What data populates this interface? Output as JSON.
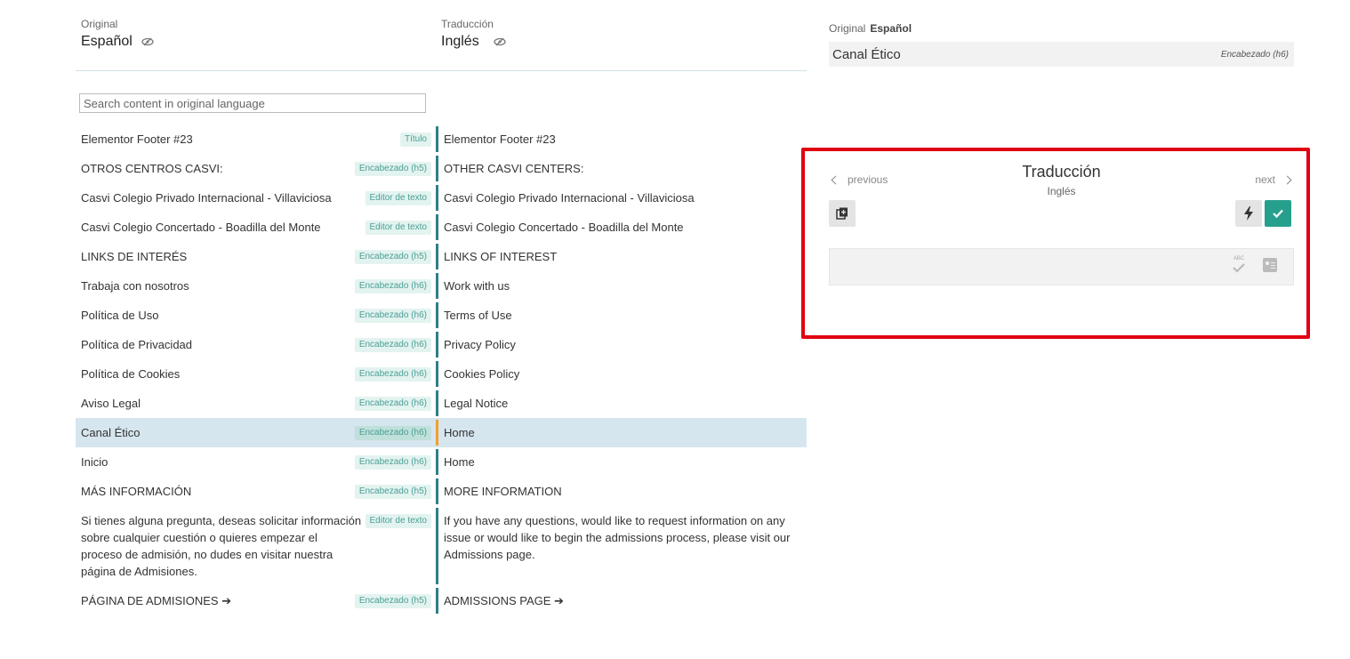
{
  "header": {
    "original_caption": "Original",
    "original_lang": "Español",
    "translation_caption": "Traducción",
    "translation_lang": "Inglés"
  },
  "search": {
    "placeholder": "Search content in original language"
  },
  "rows": [
    {
      "orig": "Elementor Footer #23",
      "tag": "Título",
      "trans": "Elementor Footer #23"
    },
    {
      "orig": "OTROS CENTROS CASVI:",
      "tag": "Encabezado (h5)",
      "trans": "OTHER CASVI CENTERS:"
    },
    {
      "orig": "Casvi Colegio Privado Internacional - Villaviciosa",
      "tag": "Editor de texto",
      "trans": "Casvi Colegio Privado Internacional - Villaviciosa"
    },
    {
      "orig": "Casvi Colegio Concertado - Boadilla del Monte",
      "tag": "Editor de texto",
      "trans": "Casvi Colegio Concertado - Boadilla del Monte"
    },
    {
      "orig": "LINKS DE INTERÉS",
      "tag": "Encabezado (h5)",
      "trans": "LINKS OF INTEREST"
    },
    {
      "orig": "Trabaja con nosotros",
      "tag": "Encabezado (h6)",
      "trans": "Work with us"
    },
    {
      "orig": "Política de Uso",
      "tag": "Encabezado (h6)",
      "trans": "Terms of Use"
    },
    {
      "orig": "Política de Privacidad",
      "tag": "Encabezado (h6)",
      "trans": "Privacy Policy"
    },
    {
      "orig": "Política de Cookies",
      "tag": "Encabezado (h6)",
      "trans": "Cookies Policy"
    },
    {
      "orig": "Aviso Legal",
      "tag": "Encabezado (h6)",
      "trans": "Legal Notice"
    },
    {
      "orig": "Canal Ético",
      "tag": "Encabezado (h6)",
      "trans": "Home"
    },
    {
      "orig": "Inicio",
      "tag": "Encabezado (h6)",
      "trans": "Home"
    },
    {
      "orig": "MÁS INFORMACIÓN",
      "tag": "Encabezado (h5)",
      "trans": "MORE INFORMATION"
    },
    {
      "orig": "Si tienes alguna pregunta, deseas solicitar información sobre cualquier cuestión o quieres empezar el proceso de admisión, no dudes en visitar nuestra página de Admisiones.",
      "tag": "Editor de texto",
      "trans": "If you have any questions, would like to request information on any issue or would like to begin the admissions process, please visit our Admissions page."
    },
    {
      "orig": "PÁGINA DE ADMISIONES ➔",
      "tag": "Encabezado (h5)",
      "trans": "ADMISSIONS PAGE ➔"
    }
  ],
  "selected_row": 10,
  "right": {
    "original_caption": "Original",
    "original_lang": "Español",
    "original_text": "Canal Ético",
    "original_kind": "Encabezado (h6)",
    "panel_title": "Traducción",
    "panel_lang": "Inglés",
    "prev_label": "previous",
    "next_label": "next",
    "spell_abc": "ABC"
  },
  "icons": {
    "eye": "eye-slash-icon",
    "copy": "copy-original-icon",
    "bolt": "machine-translate-icon",
    "check": "check-icon",
    "spell": "spellcheck-icon",
    "glossary": "glossary-icon"
  },
  "colors": {
    "accent": "#26a08c",
    "bar": "#2e7f8a",
    "selected_bar": "#f0a030",
    "selected_bg": "#d6e6ef",
    "highlight": "#e00010"
  }
}
